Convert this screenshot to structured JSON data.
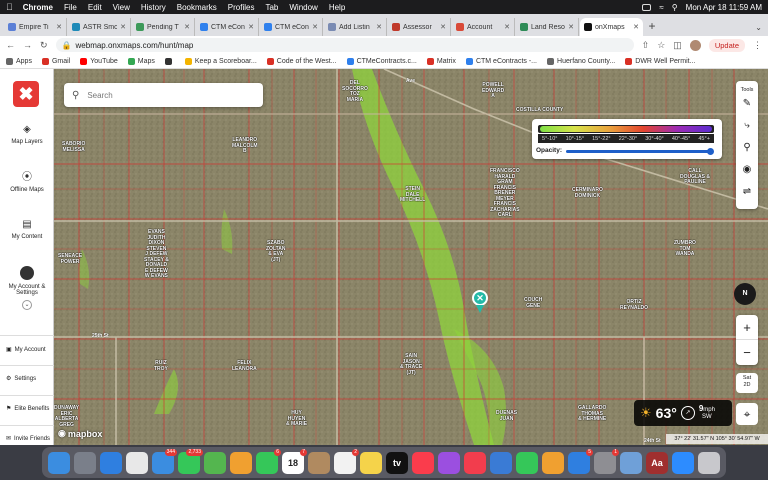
{
  "menubar": {
    "app": "Chrome",
    "items": [
      "File",
      "Edit",
      "View",
      "History",
      "Bookmarks",
      "Profiles",
      "Tab",
      "Window",
      "Help"
    ],
    "datetime": "Mon Apr 18  11:59 AM"
  },
  "tabs": [
    {
      "label": "Empire Ti",
      "color": "#5b7fd6"
    },
    {
      "label": "ASTR Smo",
      "color": "#1e8ab8"
    },
    {
      "label": "Pending T",
      "color": "#3d9a5a"
    },
    {
      "label": "CTM eCon",
      "color": "#2f80ed"
    },
    {
      "label": "CTM eCon",
      "color": "#2f80ed"
    },
    {
      "label": "Add Listin",
      "color": "#7a8bb3"
    },
    {
      "label": "Assessor",
      "color": "#c0392b"
    },
    {
      "label": "Account",
      "color": "#d94a38"
    },
    {
      "label": "Land Reso",
      "color": "#2e8b57"
    },
    {
      "label": "onXmaps",
      "color": "#111111",
      "active": true
    }
  ],
  "address": {
    "url": "webmap.onxmaps.com/hunt/map",
    "update_label": "Update"
  },
  "bookmarks": [
    {
      "label": "Apps",
      "color": "#666666"
    },
    {
      "label": "Gmail",
      "color": "#d93025"
    },
    {
      "label": "YouTube",
      "color": "#ff0000"
    },
    {
      "label": "Maps",
      "color": "#34a853"
    },
    {
      "label": "",
      "color": "#333333"
    },
    {
      "label": "Keep a Scoreboar...",
      "color": "#f4b400"
    },
    {
      "label": "Code of the West...",
      "color": "#d93025"
    },
    {
      "label": "CTMeContracts.c...",
      "color": "#2f80ed"
    },
    {
      "label": "Matrix",
      "color": "#d93025"
    },
    {
      "label": "CTM eContracts -...",
      "color": "#2f80ed"
    },
    {
      "label": "Huerfano County...",
      "color": "#666666"
    },
    {
      "label": "DWR Well Permit...",
      "color": "#d93025"
    }
  ],
  "sidebar": {
    "items": [
      {
        "label": "Map Layers",
        "icon": "◈"
      },
      {
        "label": "Offline Maps",
        "icon": "⦿"
      },
      {
        "label": "My Content",
        "icon": "▤"
      },
      {
        "label": "My Account & Settings"
      }
    ],
    "options": [
      {
        "label": "My Account",
        "icon": "▣"
      },
      {
        "label": "Settings",
        "icon": "⚙"
      },
      {
        "label": "Elite Benefits",
        "icon": "⚑"
      },
      {
        "label": "Invite Friends",
        "icon": "✉"
      }
    ]
  },
  "search": {
    "placeholder": "Search"
  },
  "legend": {
    "ranges": [
      "5°-10°",
      "10°-15°",
      "15°-22°",
      "22°-30°",
      "30°-40°",
      "40°-45°",
      "45°+"
    ],
    "opacity_label": "Opacity:",
    "opacity_value": 1.0
  },
  "tools": {
    "title": "Tools"
  },
  "compass": "N",
  "layer_toggle": {
    "line1": "Sat",
    "line2": "2D"
  },
  "weather": {
    "temp": "63°",
    "wind_speed": "9",
    "wind_unit": "mph",
    "wind_dir": "SW"
  },
  "coords": "37° 22' 31.57\" N 105° 30' 54.97\" W",
  "attribution": "mapbox",
  "owners": [
    {
      "text": "DEL\nSOCORRO\nTOZ\nMARIA"
    },
    {
      "text": "POWELL\nEDWARD\nA"
    },
    {
      "text": "COSTILLA COUNTY"
    },
    {
      "text": "SABORIO\nMELISSA"
    },
    {
      "text": "LEANDRO\nMALCOLM\nB"
    },
    {
      "text": "STEIN\nDALE\nMITCHELL"
    },
    {
      "text": "FRANCISCO\nHARALD\nGRAM\nFRANCIS\nBRENER\nMEYER\nFRANCIS\nZACHARIAS\nCARL"
    },
    {
      "text": "CERMINARO\nDOMINICK"
    },
    {
      "text": "CALL\nDOUGLAS &\nPAULINE"
    },
    {
      "text": "EVANS\nJUDITH\nDIXON\nSTEVEN\nJ DEFEW\nSTACEY &\nDONALD\nE DEFEW\nW EVANS"
    },
    {
      "text": "SZABO\nZOLTAN\n& EVA\n(JT)"
    },
    {
      "text": "ZUMBRO\nTOM\nWANDA"
    },
    {
      "text": "SENEACE\nPOWER"
    },
    {
      "text": "COUCH\nGENE"
    },
    {
      "text": "ORTIZ\nREYNALDO"
    },
    {
      "text": "RUIZ\nTROY"
    },
    {
      "text": "FELIX\nLEANORA"
    },
    {
      "text": "SAIN\nJASON\n& TRACE\n(JT)"
    },
    {
      "text": "DUENAS\nJUAN"
    },
    {
      "text": "GALLARDO\nTHOMAS\n& HERMINE"
    },
    {
      "text": "DUNAWAY\nERIC\nALBERTA\nGREG"
    },
    {
      "text": "HUY\nHUYEN\n& MARIE"
    }
  ],
  "roads": [
    {
      "label": "25th St"
    },
    {
      "label": "24th St"
    },
    {
      "label": "Ave"
    }
  ],
  "dock": {
    "apps": [
      {
        "name": "Finder",
        "color": "#3b8de0"
      },
      {
        "name": "Launchpad",
        "color": "#7a7f8a"
      },
      {
        "name": "Safari",
        "color": "#2f7fe0"
      },
      {
        "name": "Chrome",
        "color": "#e8e8e8"
      },
      {
        "name": "Mail",
        "color": "#3b8de0",
        "badge": "344"
      },
      {
        "name": "Messages",
        "color": "#35c759",
        "badge": "2,733"
      },
      {
        "name": "Maps",
        "color": "#54b64f"
      },
      {
        "name": "Photos",
        "color": "#f0a030"
      },
      {
        "name": "FaceTime",
        "color": "#35c759",
        "badge": "6"
      },
      {
        "name": "Calendar",
        "color": "#ffffff",
        "badge": "7",
        "text": "18"
      },
      {
        "name": "Contacts",
        "color": "#b08a60"
      },
      {
        "name": "Reminders",
        "color": "#f2f2f2",
        "badge": "2"
      },
      {
        "name": "Notes",
        "color": "#f5d34a"
      },
      {
        "name": "TV",
        "color": "#111111",
        "text": "tv"
      },
      {
        "name": "Music",
        "color": "#fa3c4c"
      },
      {
        "name": "Podcasts",
        "color": "#9b4fe0"
      },
      {
        "name": "News",
        "color": "#f23d4d"
      },
      {
        "name": "Keynote",
        "color": "#3a7bd5"
      },
      {
        "name": "Numbers",
        "color": "#35c759"
      },
      {
        "name": "Pages",
        "color": "#f0a030"
      },
      {
        "name": "App Store",
        "color": "#2f7fe0",
        "badge": "5"
      },
      {
        "name": "System Preferences",
        "color": "#8e8e93",
        "badge": "1"
      },
      {
        "name": "Preview",
        "color": "#6fa0d8"
      },
      {
        "name": "Dictionary",
        "color": "#a02f2f",
        "text": "Aa"
      },
      {
        "name": "Zoom",
        "color": "#2d8cff"
      },
      {
        "name": "Trash",
        "color": "#c8c8cc"
      }
    ]
  }
}
